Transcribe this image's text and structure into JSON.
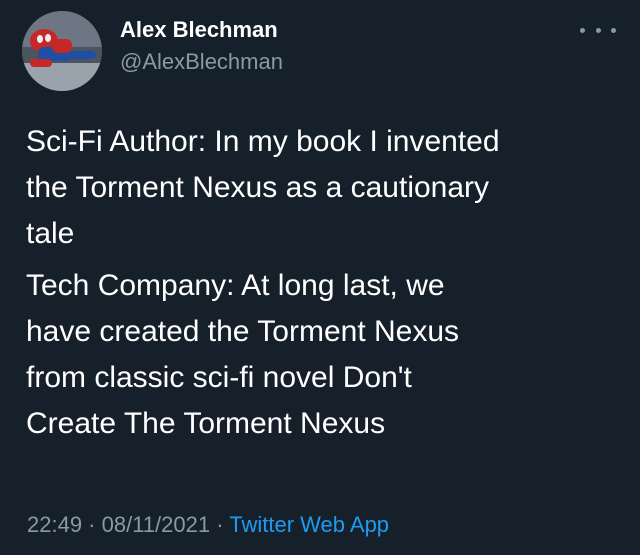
{
  "author": {
    "display_name": "Alex Blechman",
    "handle": "@AlexBlechman",
    "avatar_icon": "spider-man-avatar"
  },
  "menu_icon": "more-options-icon",
  "tweet": {
    "paragraphs": [
      "Sci-Fi Author: In my book I invented\nthe Torment Nexus as a cautionary\ntale",
      "Tech Company: At long last, we\nhave created the Torment Nexus\nfrom classic sci-fi novel Don't\nCreate The Torment Nexus"
    ]
  },
  "meta": {
    "time": "22:49",
    "separator": " · ",
    "date": "08/11/2021",
    "source": "Twitter Web App"
  },
  "colors": {
    "background": "#15202b",
    "text": "#ffffff",
    "secondary": "#8b98a5",
    "link": "#1d9bf0"
  }
}
